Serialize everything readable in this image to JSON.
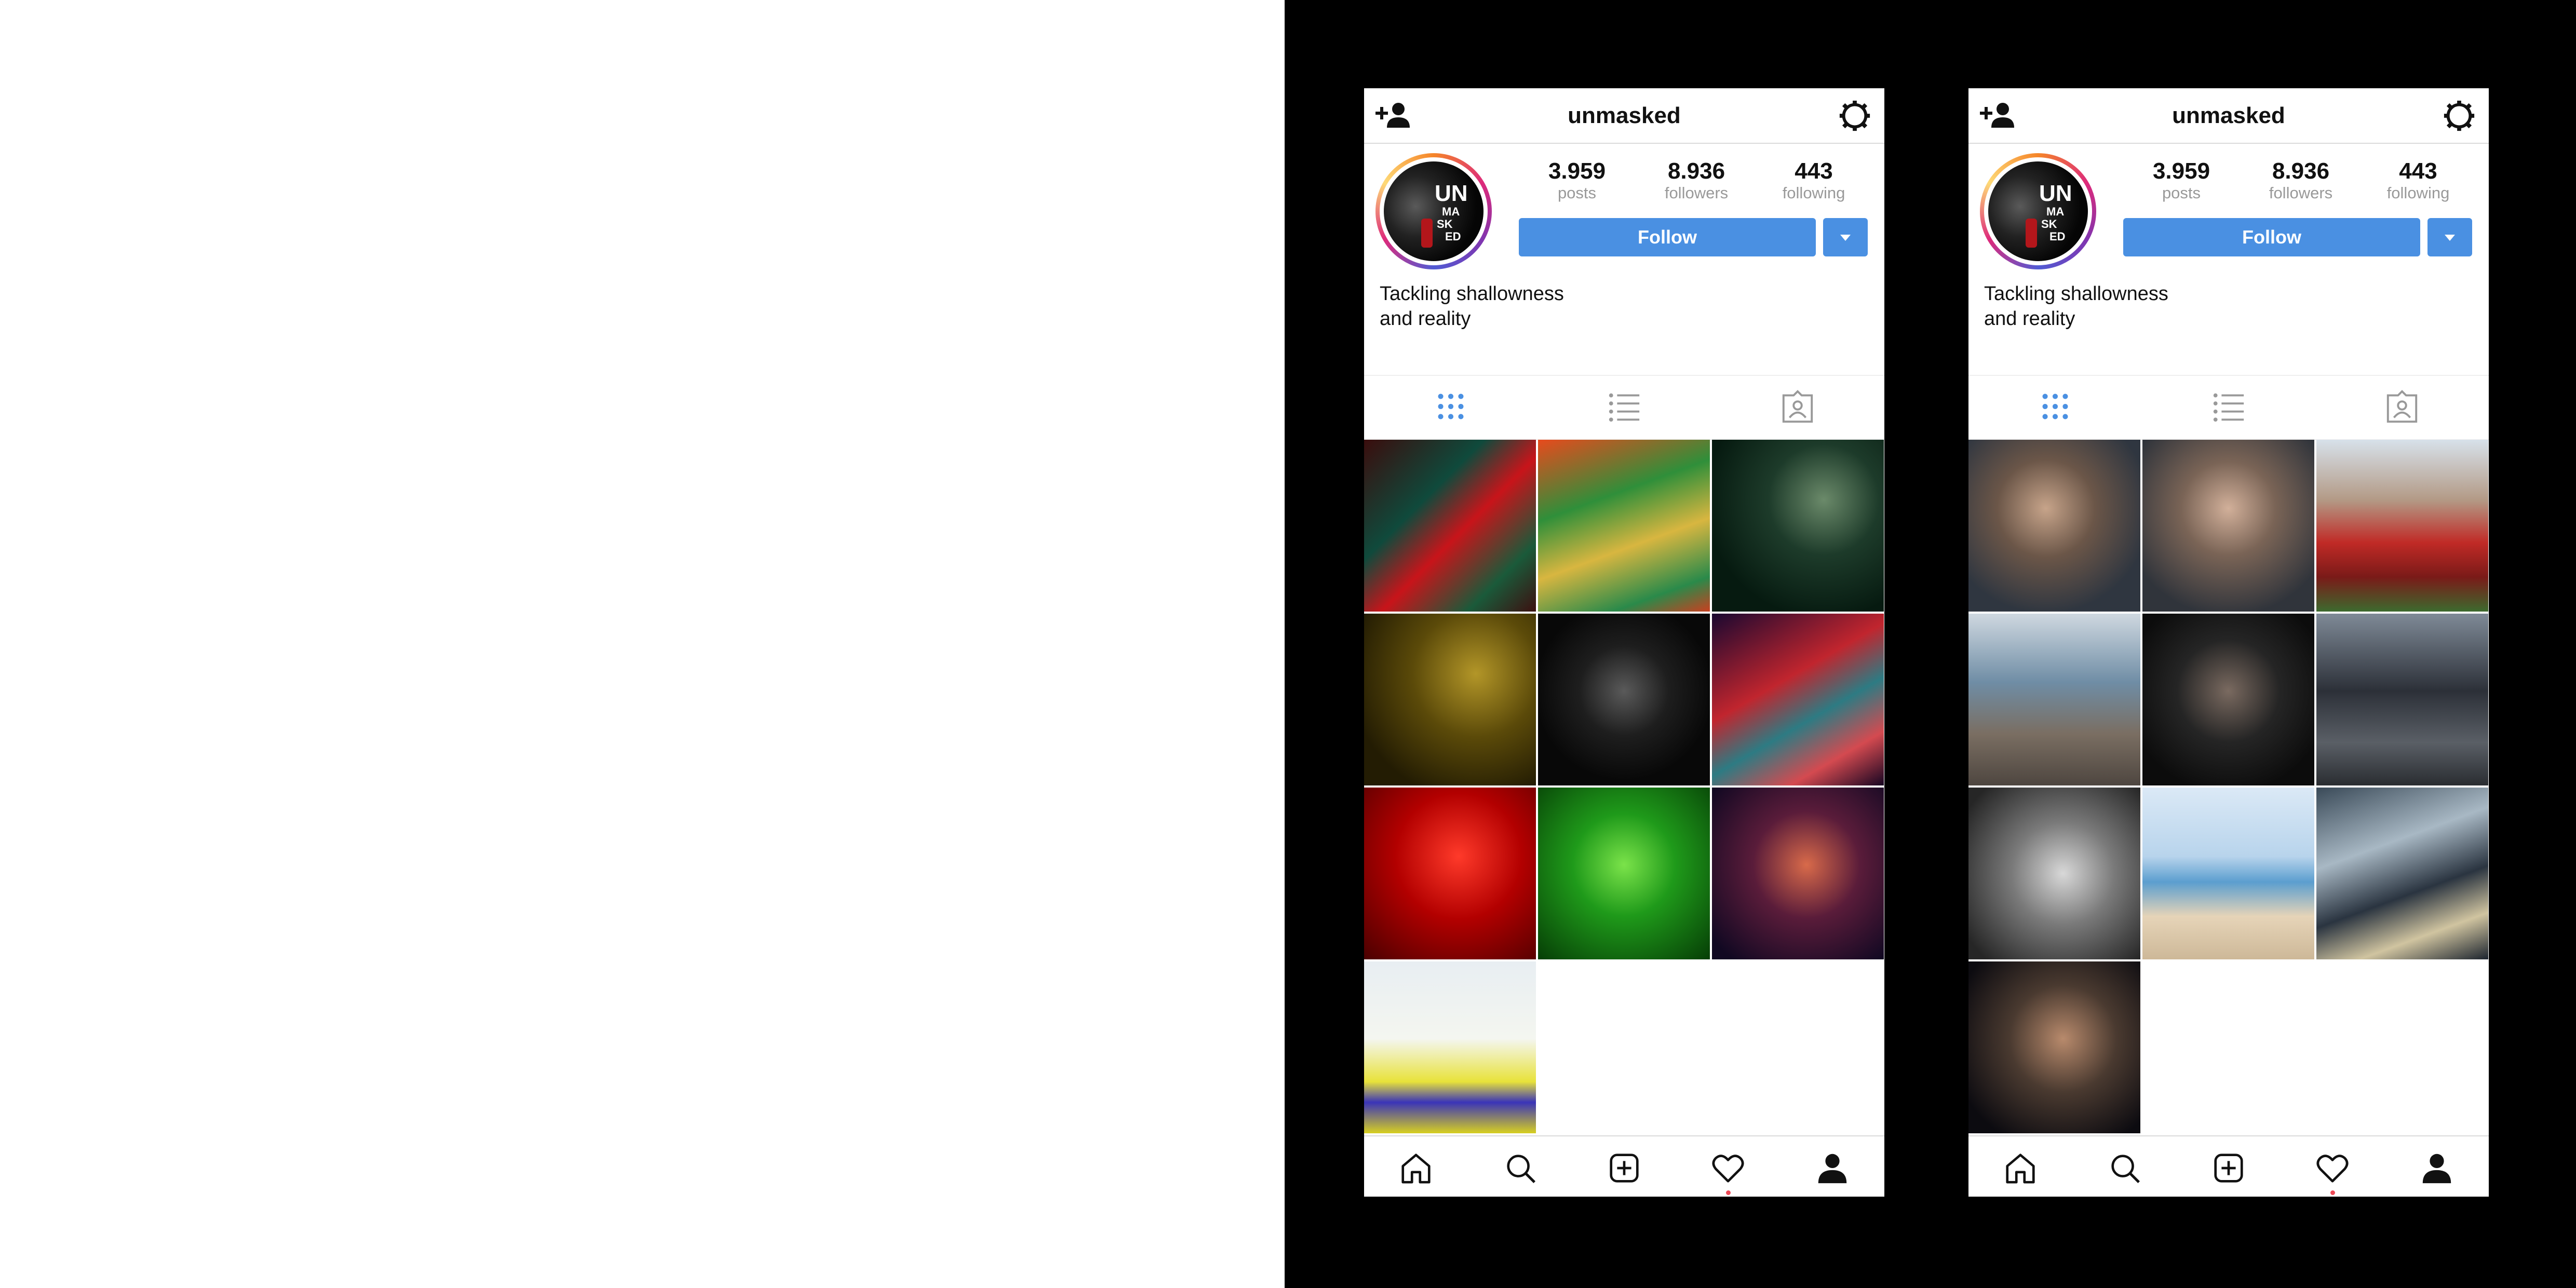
{
  "colors": {
    "accent": "#4a90e2",
    "notification": "#ed4956",
    "muted": "#999999",
    "text": "#111111"
  },
  "screens": [
    {
      "id": "filtered",
      "header": {
        "username": "unmasked",
        "left_icon": "add-user-icon",
        "right_icon": "settings-icon"
      },
      "avatar": {
        "logo_lines": [
          "UN",
          "MA",
          "SK",
          "ED"
        ]
      },
      "stats": [
        {
          "value": "3.959",
          "label": "posts"
        },
        {
          "value": "8.936",
          "label": "followers"
        },
        {
          "value": "443",
          "label": "following"
        }
      ],
      "follow_label": "Follow",
      "bio_lines": [
        "Tackling shallowness",
        "and reality"
      ],
      "tabs": [
        "grid-icon",
        "list-icon",
        "tagged-icon"
      ],
      "active_tab": "grid-icon",
      "nav": [
        "home-icon",
        "search-icon",
        "new-post-icon",
        "activity-icon",
        "profile-icon"
      ],
      "photos": [
        {
          "subject": "street scene in red and green tint"
        },
        {
          "subject": "person among autumn leaves, green-orange tint"
        },
        {
          "subject": "man in bar, dark green tint"
        },
        {
          "subject": "night street, yellow tint"
        },
        {
          "subject": "man with cap and phone, dark tone"
        },
        {
          "subject": "man in red-blue duotone"
        },
        {
          "subject": "man smoking, red tint"
        },
        {
          "subject": "man smiling, green tint"
        },
        {
          "subject": "long-haired man, red-purple tint"
        },
        {
          "subject": "woman on beach, yellow-blue tint"
        }
      ]
    },
    {
      "id": "original",
      "header": {
        "username": "unmasked",
        "left_icon": "add-user-icon",
        "right_icon": "settings-icon"
      },
      "avatar": {
        "logo_lines": [
          "UN",
          "MA",
          "SK",
          "ED"
        ]
      },
      "stats": [
        {
          "value": "3.959",
          "label": "posts"
        },
        {
          "value": "8.936",
          "label": "followers"
        },
        {
          "value": "443",
          "label": "following"
        }
      ],
      "follow_label": "Follow",
      "bio_lines": [
        "Tackling shallowness",
        "and reality"
      ],
      "tabs": [
        "grid-icon",
        "list-icon",
        "tagged-icon"
      ],
      "active_tab": "grid-icon",
      "nav": [
        "home-icon",
        "search-icon",
        "new-post-icon",
        "activity-icon",
        "profile-icon"
      ],
      "photos": [
        {
          "subject": "young man portrait, looking left"
        },
        {
          "subject": "young man smiling portrait"
        },
        {
          "subject": "woman with red roses"
        },
        {
          "subject": "person reading by the sea"
        },
        {
          "subject": "man with cap and phone"
        },
        {
          "subject": "man at table with laptop"
        },
        {
          "subject": "woman in black and white"
        },
        {
          "subject": "woman on beach"
        },
        {
          "subject": "person with surfboard on rocks"
        },
        {
          "subject": "long-haired man at night"
        }
      ]
    }
  ]
}
